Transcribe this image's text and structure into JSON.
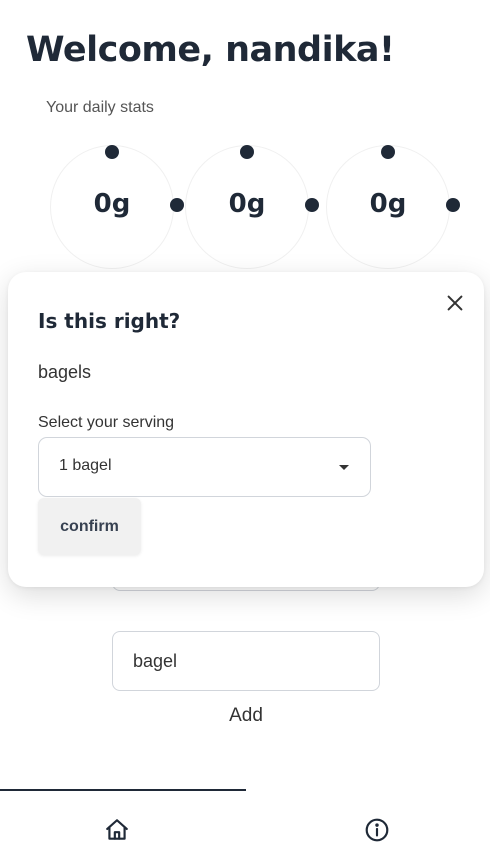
{
  "header": {
    "title": "Welcome, nandika!",
    "subtitle": "Your daily stats"
  },
  "stats": [
    {
      "value": "0g"
    },
    {
      "value": "0g"
    },
    {
      "value": "0g"
    }
  ],
  "form": {
    "food_input_value": "bagel",
    "add_label": "Add"
  },
  "modal": {
    "title": "Is this right?",
    "food_name": "bagels",
    "serving_label": "Select your serving",
    "serving_selected": "1 bagel",
    "confirm_label": "confirm",
    "close_icon": "close-icon"
  },
  "nav": {
    "items": [
      {
        "icon": "home-icon"
      },
      {
        "icon": "info-icon"
      }
    ],
    "active_index": 0
  },
  "colors": {
    "text_dark": "#1f2937",
    "border": "#d1d5db",
    "button_bg": "#f1f1f1"
  }
}
